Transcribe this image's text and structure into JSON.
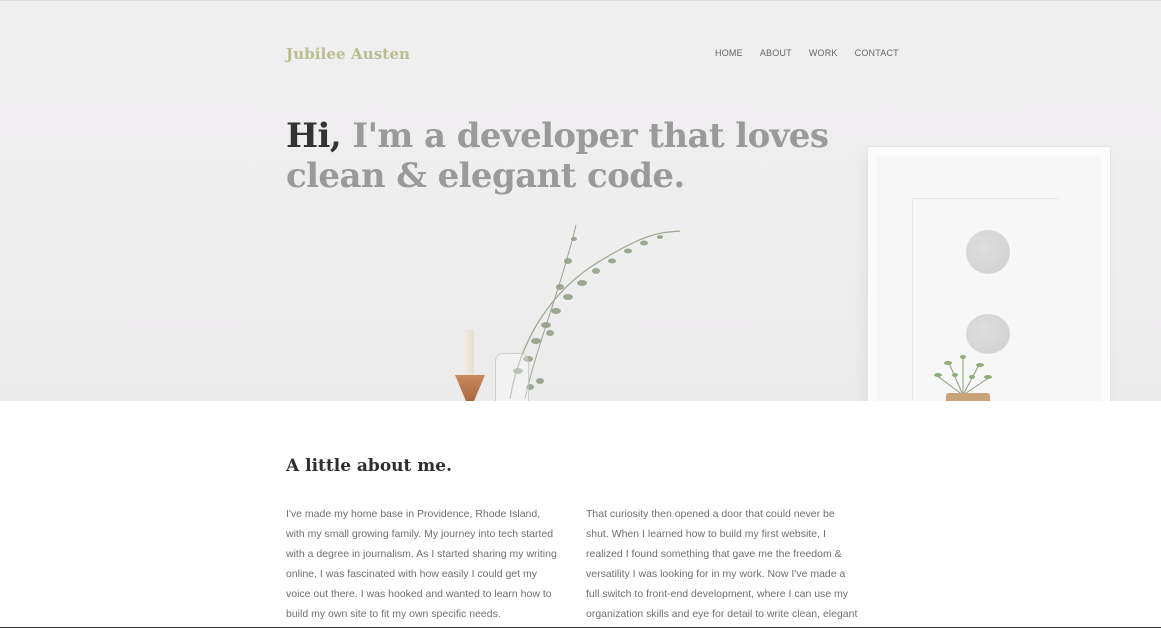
{
  "site": {
    "brand": "Jubilee Austen",
    "nav": [
      "HOME",
      "ABOUT",
      "WORK",
      "CONTACT"
    ]
  },
  "hero": {
    "hi": "Hi,",
    "headline_rest": " I'm a developer that loves clean & elegant code."
  },
  "about": {
    "title": "A little about me.",
    "paragraph_left": "I've made my home base in Providence, Rhode Island, with my small growing family. My journey into tech started with a degree in journalism. As I started sharing my writing online, I was fascinated with how easily I could get my voice out there. I was hooked and wanted to learn how to build my own site to fit my own specific needs.",
    "paragraph_right": "That curiosity then opened a door that could never be shut. When I learned how to build my first website, I realized I found something that gave me the freedom & versatility I was looking for in my work. Now I've made a full switch to front-end development, where I can use my organization skills and eye for detail to write clean, elegant code."
  },
  "colors": {
    "brand": "#b9bd8f",
    "headline_muted": "#9a9a9a",
    "headline_dark": "#333333"
  }
}
